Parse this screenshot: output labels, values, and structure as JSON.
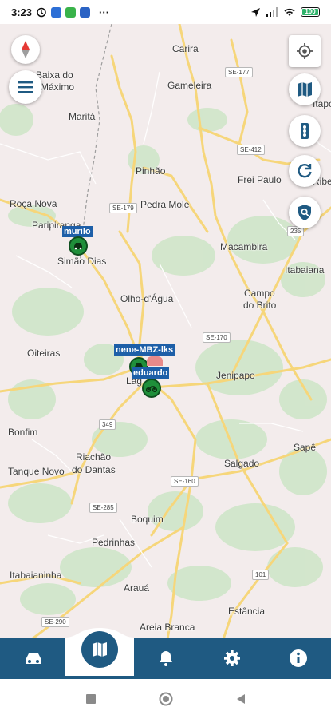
{
  "status_bar": {
    "time": "3:23",
    "more": "···",
    "battery": "100"
  },
  "map": {
    "places": [
      {
        "name": "Carira"
      },
      {
        "name": "Gameleira"
      },
      {
        "name": "Baixa do"
      },
      {
        "name": "Máximo"
      },
      {
        "name": "Maritá"
      },
      {
        "name": "Pinhão"
      },
      {
        "name": "Frei Paulo"
      },
      {
        "name": "Roça Nova"
      },
      {
        "name": "Pedra Mole"
      },
      {
        "name": "Paripiranga"
      },
      {
        "name": "Simão Dias"
      },
      {
        "name": "Macambira"
      },
      {
        "name": "Itabaiana"
      },
      {
        "name": "Olho-d'Água"
      },
      {
        "name": "Campo"
      },
      {
        "name": "do Brito"
      },
      {
        "name": "Oiteiras"
      },
      {
        "name": "Jenipapo"
      },
      {
        "name": "Bonfim"
      },
      {
        "name": "Riachão"
      },
      {
        "name": "do Dantas"
      },
      {
        "name": "Tanque Novo"
      },
      {
        "name": "Salgado"
      },
      {
        "name": "Sapê"
      },
      {
        "name": "Boquim"
      },
      {
        "name": "Pedrinhas"
      },
      {
        "name": "Itabaianinha"
      },
      {
        "name": "Arauá"
      },
      {
        "name": "Estância"
      },
      {
        "name": "Areia Branca"
      },
      {
        "name": "Itapor"
      },
      {
        "name": "Ribeirop"
      },
      {
        "name": "Lag"
      }
    ],
    "roads": [
      {
        "label": "SE-177"
      },
      {
        "label": "SE-412"
      },
      {
        "label": "SE-179"
      },
      {
        "label": "235"
      },
      {
        "label": "SE-170"
      },
      {
        "label": "349"
      },
      {
        "label": "SE-160"
      },
      {
        "label": "SE-285"
      },
      {
        "label": "101"
      },
      {
        "label": "SE-290"
      }
    ],
    "vehicles": [
      {
        "label": "murilo"
      },
      {
        "label": "nene-MBZ-lks"
      },
      {
        "label": "eduardo"
      }
    ]
  },
  "map_controls": {
    "compass_icon": "compass-icon",
    "menu_icon": "hamburger-menu-icon",
    "location_icon": "my-location-icon",
    "layers_icon": "map-layers-icon",
    "traffic_icon": "traffic-light-icon",
    "refresh_icon": "refresh-icon",
    "search_icon": "search-vehicle-icon"
  },
  "bottom_nav": {
    "items": [
      "vehicles",
      "map",
      "notifications",
      "settings",
      "info"
    ],
    "active": "map",
    "color": "#1f5a82"
  }
}
